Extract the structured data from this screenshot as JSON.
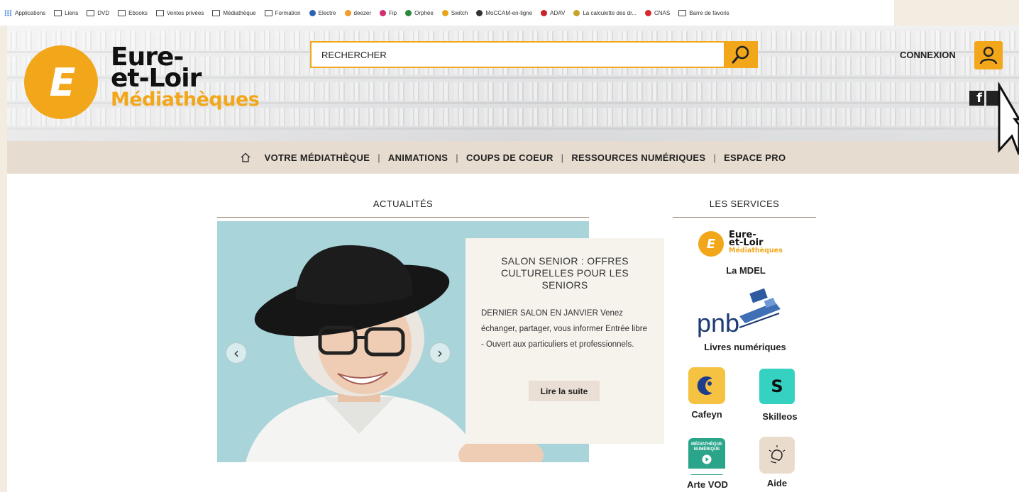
{
  "bookmarks": [
    {
      "label": "Applications",
      "icon": "apps-grid-icon",
      "color": "#3b7ddd"
    },
    {
      "label": "Liens",
      "icon": "folder-icon"
    },
    {
      "label": "DVD",
      "icon": "folder-icon"
    },
    {
      "label": "Ebooks",
      "icon": "folder-icon"
    },
    {
      "label": "Ventes privées",
      "icon": "folder-icon"
    },
    {
      "label": "Médiathèque",
      "icon": "folder-icon"
    },
    {
      "label": "Formation",
      "icon": "folder-icon"
    },
    {
      "label": "Electre",
      "icon": "electre-icon"
    },
    {
      "label": "deezer",
      "icon": "deezer-icon"
    },
    {
      "label": "Fip",
      "icon": "fip-icon"
    },
    {
      "label": "Orphée",
      "icon": "orphee-icon"
    },
    {
      "label": "Switch",
      "icon": "switch-icon"
    },
    {
      "label": "MoCCAM-en-ligne",
      "icon": "moccam-icon"
    },
    {
      "label": "ADAV",
      "icon": "adav-icon"
    },
    {
      "label": "La calculette des dr...",
      "icon": "calculette-icon"
    },
    {
      "label": "CNAS",
      "icon": "cnas-icon"
    },
    {
      "label": "Barre de favoris",
      "icon": "folder-icon"
    }
  ],
  "header": {
    "logo_mark": "E",
    "logo_line1": "Eure-",
    "logo_line2": "et-Loir",
    "logo_line3": "Médiathèques",
    "search_placeholder": "RECHERCHER",
    "connexion": "CONNEXION",
    "facebook": "f"
  },
  "nav": {
    "items": [
      "VOTRE MÉDIATHÈQUE",
      "ANIMATIONS",
      "COUPS DE COEUR",
      "RESSOURCES NUMÉRIQUES",
      "ESPACE PRO"
    ],
    "separator": "|"
  },
  "news": {
    "section_title": "ACTUALITÉS",
    "title": "SALON SENIOR : OFFRES CULTURELLES POUR LES SENIORS",
    "text": "DERNIER SALON EN JANVIER Venez échanger, partager, vous informer Entrée libre - Ouvert aux particuliers et professionnels.",
    "button": "Lire la suite",
    "prev": "‹",
    "next": "›"
  },
  "services": {
    "section_title": "LES SERVICES",
    "mdel_logo_line1": "Eure-",
    "mdel_logo_line2": "et-Loir",
    "mdel_logo_line3": "Médiathèques",
    "mdel_label": "La MDEL",
    "pnb_logo": "pnb",
    "pnb_label": "Livres numériques",
    "cafeyn_label": "Cafeyn",
    "skilleos_mark": "S",
    "skilleos_label": "Skilleos",
    "arte_tile_line1": "MÉDIATHÈQUE",
    "arte_tile_line2": "NUMÉRIQUE",
    "arte_label": "Arte VOD",
    "aide_label": "Aide"
  },
  "colors": {
    "accent": "#f2a71b",
    "nav_bg": "#e6dccf",
    "page_bg": "#f3ece0",
    "slide_bg": "#a8d4da",
    "skilleos": "#35d1c1",
    "cafeyn": "#f5c242",
    "arte": "#2aa58a"
  }
}
